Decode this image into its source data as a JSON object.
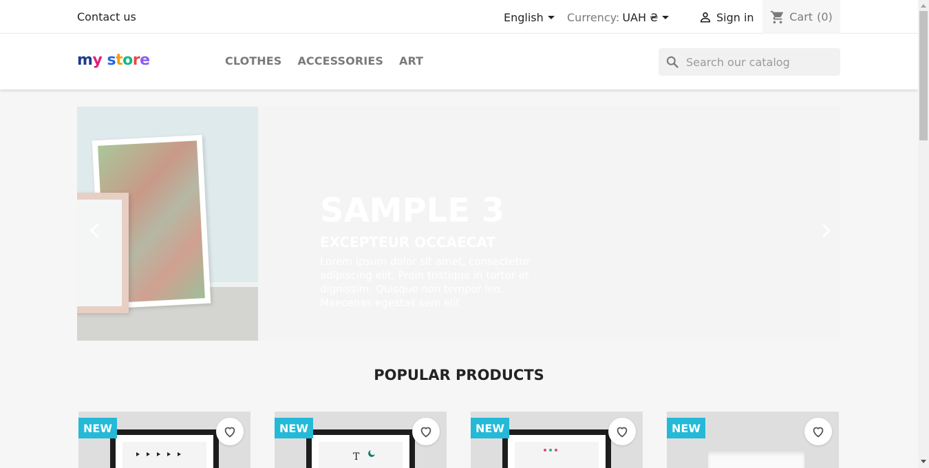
{
  "topbar": {
    "contact": "Contact us",
    "language": "English",
    "currency_label": "Currency:",
    "currency_value": "UAH ₴",
    "signin": "Sign in",
    "cart": "Cart",
    "cart_count": "(0)"
  },
  "header": {
    "logo": [
      "m",
      "y",
      " ",
      "s",
      "t",
      "o",
      "r",
      "e"
    ],
    "menu": [
      "CLOTHES",
      "ACCESSORIES",
      "ART"
    ],
    "search_placeholder": "Search our catalog"
  },
  "slider": {
    "title": "SAMPLE 3",
    "subtitle": "EXCEPTEUR OCCAECAT",
    "description": "Lorem ipsum dolor sit amet, consectetur adipiscing elit. Proin tristique in tortor et dignissim. Quisque non tempor leo. Maecenas egestas sem elit"
  },
  "popular": {
    "title": "POPULAR PRODUCTS",
    "products": [
      {
        "badge": "NEW"
      },
      {
        "badge": "NEW"
      },
      {
        "badge": "NEW"
      },
      {
        "badge": "NEW"
      }
    ]
  },
  "colors": {
    "badge": "#24b9d7",
    "background": "#f6f6f6"
  },
  "icons": {
    "signin": "person-icon",
    "cart": "cart-icon",
    "search": "search-icon",
    "wishlist": "heart-icon",
    "prev": "chevron-left-icon",
    "next": "chevron-right-icon"
  }
}
